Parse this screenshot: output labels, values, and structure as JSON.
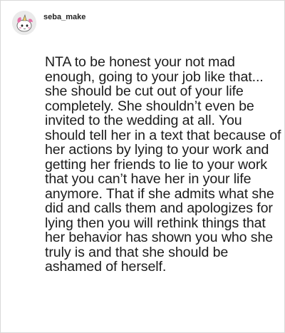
{
  "post": {
    "username": "seba_make",
    "avatar_icon": "unicorn-avatar-icon",
    "comment_text": "NTA to be honest your not mad enough, going to your job like that... she should be cut out of your life completely. She shouldn’t even be invited to the wedding at all. You should tell her in a text that because of her actions by lying to your work and getting her friends to lie to your work that you can’t have her in your life anymore. That if she admits what she did and calls them and apologizes for lying then you will rethink things that her behavior has shown you who she truly is and that she should be ashamed of herself."
  },
  "colors": {
    "avatar_bg": "#e8e8e8",
    "unicorn_pink": "#e56fa6",
    "border": "#d9d9d9"
  }
}
